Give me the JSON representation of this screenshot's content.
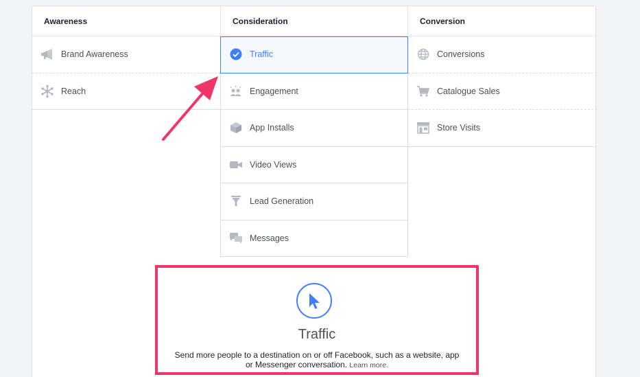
{
  "columns": [
    {
      "header": "Awareness",
      "items": [
        {
          "label": "Brand Awareness",
          "icon": "megaphone-icon"
        },
        {
          "label": "Reach",
          "icon": "reach-icon"
        }
      ]
    },
    {
      "header": "Consideration",
      "items": [
        {
          "label": "Traffic",
          "icon": "check-circle-icon",
          "selected": true
        },
        {
          "label": "Engagement",
          "icon": "people-icon"
        },
        {
          "label": "App Installs",
          "icon": "box-icon"
        },
        {
          "label": "Video Views",
          "icon": "video-camera-icon"
        },
        {
          "label": "Lead Generation",
          "icon": "funnel-icon"
        },
        {
          "label": "Messages",
          "icon": "chat-bubbles-icon"
        }
      ]
    },
    {
      "header": "Conversion",
      "items": [
        {
          "label": "Conversions",
          "icon": "globe-icon"
        },
        {
          "label": "Catalogue Sales",
          "icon": "cart-icon"
        },
        {
          "label": "Store Visits",
          "icon": "store-icon"
        }
      ]
    }
  ],
  "detail": {
    "title": "Traffic",
    "description": "Send more people to a destination on or off Facebook, such as a website, app or Messenger conversation.",
    "learn_more": "Learn more."
  },
  "colors": {
    "accent": "#4080ff",
    "highlight": "#f0356b",
    "icon": "#9197a3"
  }
}
